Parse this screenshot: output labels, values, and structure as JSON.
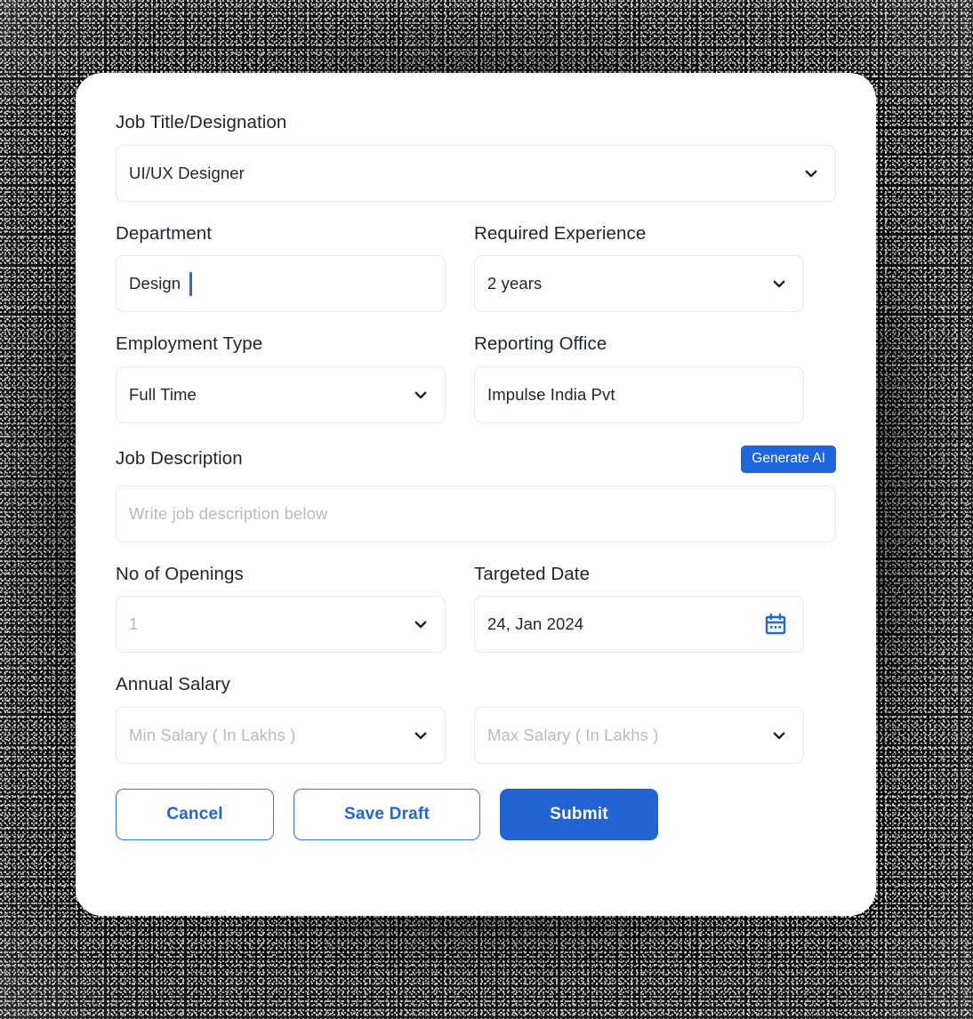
{
  "theme": {
    "accent_blue": "#2163d0",
    "generate_blue": "#1f66de",
    "outline_blue": "#2f78ee",
    "label_color": "#1d2333",
    "placeholder_color": "#b8babf",
    "border_color": "#e7e8ea",
    "card_background": "#ffffff",
    "page_background": "#000000",
    "caret_color": "#1f6fe0"
  },
  "form": {
    "job_title": {
      "label": "Job Title/Designation",
      "value": "UI/UX Designer",
      "icon": "chevron-down-icon"
    },
    "department": {
      "label": "Department",
      "value": "Design",
      "focused": true
    },
    "required_experience": {
      "label": "Required Experience",
      "value": "2 years",
      "icon": "chevron-down-icon"
    },
    "employment_type": {
      "label": "Employment Type",
      "value": "Full Time",
      "icon": "chevron-down-icon"
    },
    "reporting_office": {
      "label": "Reporting Office",
      "value": "Impulse India Pvt"
    },
    "job_description": {
      "label": "Job Description",
      "placeholder": "Write job description below",
      "value": "",
      "generate_button": "Generate AI"
    },
    "no_of_openings": {
      "label": "No of Openings",
      "placeholder": "1",
      "value": "",
      "icon": "chevron-down-icon"
    },
    "targeted_date": {
      "label": "Targeted Date",
      "value": "24, Jan 2024",
      "icon": "calendar-icon"
    },
    "annual_salary": {
      "label": "Annual Salary",
      "min": {
        "placeholder": "Min Salary ( In Lakhs )",
        "value": "",
        "icon": "chevron-down-icon"
      },
      "max": {
        "placeholder": "Max Salary ( In Lakhs )",
        "value": "",
        "icon": "chevron-down-icon"
      }
    }
  },
  "actions": {
    "cancel": "Cancel",
    "save_draft": "Save Draft",
    "submit": "Submit"
  }
}
